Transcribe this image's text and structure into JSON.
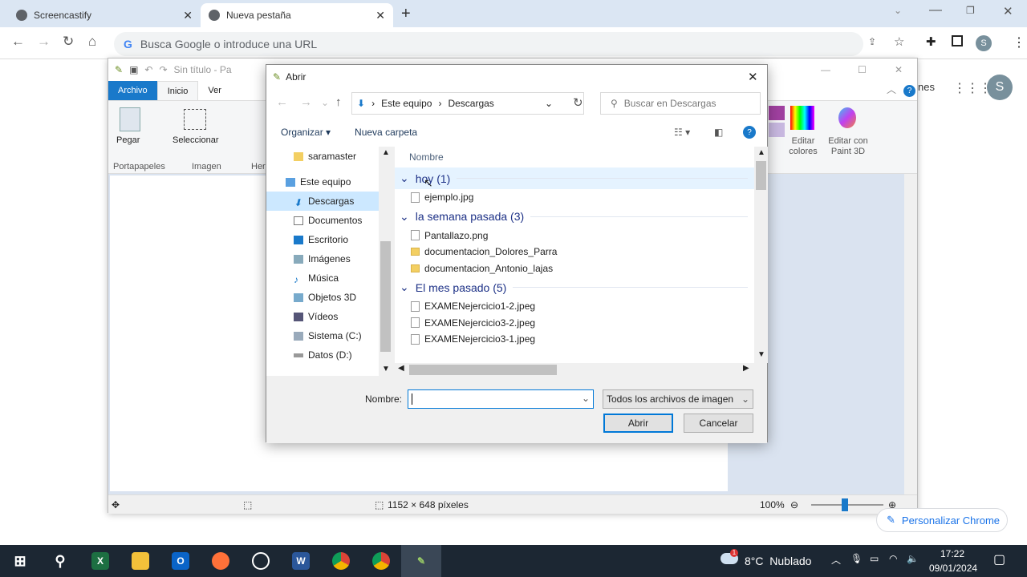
{
  "browser": {
    "tabs": [
      {
        "label": "Screencastify",
        "active": false
      },
      {
        "label": "Nueva pestaña",
        "active": true
      }
    ],
    "omnibox_placeholder": "Busca Google o introduce una URL",
    "profile_initial": "S",
    "page_partial_text": "nes",
    "customize_label": "Personalizar Chrome"
  },
  "paint": {
    "title": "Sin título - Pa",
    "tabs": [
      "Archivo",
      "Inicio",
      "Ver"
    ],
    "ribbon": {
      "paste": "Pegar",
      "select": "Seleccionar",
      "groups": [
        "Portapapeles",
        "Imagen",
        "Herr"
      ],
      "edit_colors": "Editar colores",
      "edit_paint3d": "Editar con Paint 3D"
    },
    "status": {
      "dimensions": "1152 × 648 píxeles",
      "zoom": "100%"
    }
  },
  "dialog": {
    "title": "Abrir",
    "breadcrumb": [
      "Este equipo",
      "Descargas"
    ],
    "search_placeholder": "Buscar en Descargas",
    "organize": "Organizar",
    "new_folder": "Nueva carpeta",
    "tree": [
      {
        "label": "saramaster",
        "icon": "folder"
      },
      {
        "label": "Este equipo",
        "icon": "pc"
      },
      {
        "label": "Descargas",
        "icon": "download",
        "selected": true
      },
      {
        "label": "Documentos",
        "icon": "doc"
      },
      {
        "label": "Escritorio",
        "icon": "desktop"
      },
      {
        "label": "Imágenes",
        "icon": "image"
      },
      {
        "label": "Música",
        "icon": "music"
      },
      {
        "label": "Objetos 3D",
        "icon": "3d"
      },
      {
        "label": "Vídeos",
        "icon": "video"
      },
      {
        "label": "Sistema (C:)",
        "icon": "drive"
      },
      {
        "label": "Datos (D:)",
        "icon": "drive"
      }
    ],
    "column_header": "Nombre",
    "groups": [
      {
        "label": "hoy (1)",
        "files": [
          {
            "name": "ejemplo.jpg",
            "type": "file"
          }
        ]
      },
      {
        "label": "la semana pasada (3)",
        "files": [
          {
            "name": "Pantallazo.png",
            "type": "file"
          },
          {
            "name": "documentacion_Dolores_Parra",
            "type": "folder"
          },
          {
            "name": "documentacion_Antonio_lajas",
            "type": "folder"
          }
        ]
      },
      {
        "label": "El mes pasado (5)",
        "files": [
          {
            "name": "EXAMENejercicio1-2.jpeg",
            "type": "file"
          },
          {
            "name": "EXAMENejercicio3-2.jpeg",
            "type": "file"
          },
          {
            "name": "EXAMENejercicio3-1.jpeg",
            "type": "file"
          }
        ]
      }
    ],
    "filename_label": "Nombre:",
    "filename_value": "",
    "filter": "Todos los archivos de imagen",
    "open": "Abrir",
    "cancel": "Cancelar"
  },
  "taskbar": {
    "weather": "8°C  Nublado",
    "weather_badge": "1",
    "time": "17:22",
    "date": "09/01/2024"
  }
}
